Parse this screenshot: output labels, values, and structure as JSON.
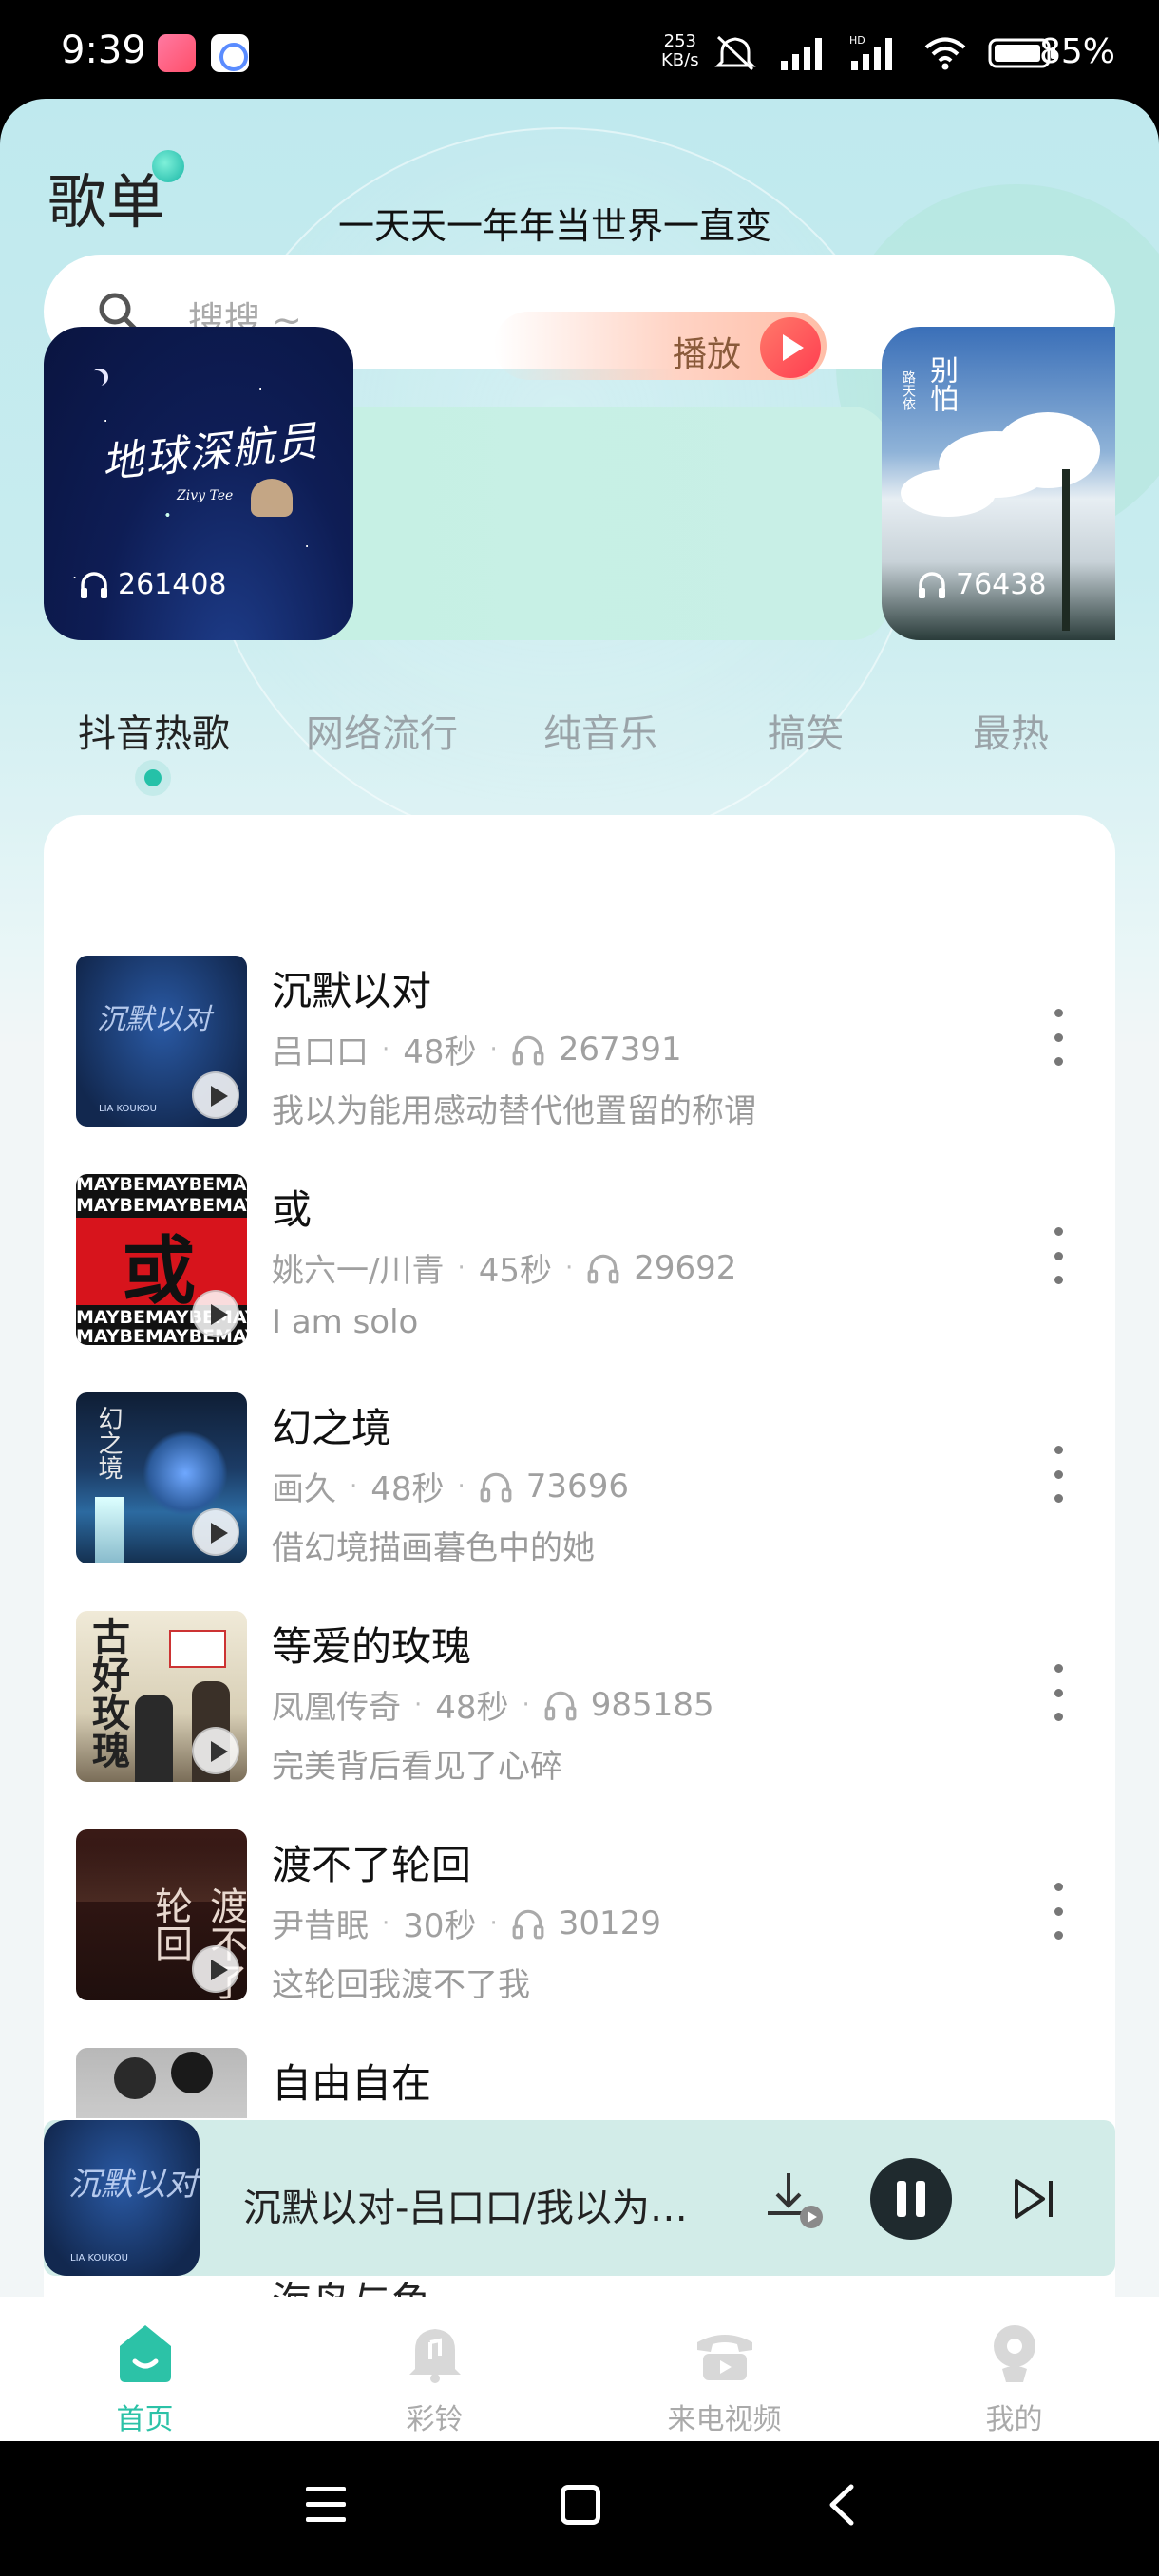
{
  "status_bar": {
    "time": "9:39",
    "net_speed_value": "253",
    "net_speed_unit": "KB/s",
    "battery": "85%",
    "icons": [
      "mute-icon",
      "signal-icon",
      "hd-signal-icon",
      "wifi-icon",
      "battery-icon"
    ]
  },
  "header": {
    "title": "歌单"
  },
  "search": {
    "placeholder": "搜搜 ~"
  },
  "banner": {
    "cover_title": "地球深航员",
    "cover_artist": "Zivy Tee",
    "play_count": "261408",
    "description": "一天天一年年当世界一直变",
    "play_label": "播放",
    "side_card": {
      "title": "别怕",
      "subtitle": "路天依",
      "play_count": "76438"
    }
  },
  "tabs": [
    {
      "label": "抖音热歌",
      "active": true
    },
    {
      "label": "网络流行",
      "active": false
    },
    {
      "label": "纯音乐",
      "active": false
    },
    {
      "label": "搞笑",
      "active": false
    },
    {
      "label": "最热",
      "active": false
    }
  ],
  "songs": [
    {
      "title": "沉默以对",
      "artist": "吕口口",
      "duration": "48秒",
      "plays": "267391",
      "lyric": "我以为能用感动替代他置留的称谓",
      "cover_text": "沉默以对"
    },
    {
      "title": "或",
      "artist": "姚六一/川青",
      "duration": "45秒",
      "plays": "29692",
      "lyric": "I am solo",
      "cover_text": "或"
    },
    {
      "title": "幻之境",
      "artist": "画久",
      "duration": "48秒",
      "plays": "73696",
      "lyric": "借幻境描画暮色中的她",
      "cover_text": "幻之境"
    },
    {
      "title": "等爱的玫瑰",
      "artist": "凤凰传奇",
      "duration": "48秒",
      "plays": "985185",
      "lyric": "完美背后看见了心碎",
      "cover_text": "古好玫瑰"
    },
    {
      "title": "渡不了轮回",
      "artist": "尹昔眠",
      "duration": "30秒",
      "plays": "30129",
      "lyric": "这轮回我渡不了我",
      "cover_text": "渡不了轮回"
    },
    {
      "title": "自由自在",
      "artist": "",
      "duration": "",
      "plays": "",
      "lyric": "",
      "cover_text": ""
    }
  ],
  "peek_song_title": "海鸟与鱼",
  "mini_player": {
    "title": "沉默以对-吕口口/我以为能用感动替代他置留的称谓",
    "cover_text": "沉默以对"
  },
  "bottom_nav": [
    {
      "label": "首页",
      "icon": "home-icon",
      "active": true
    },
    {
      "label": "彩铃",
      "icon": "bell-icon",
      "active": false
    },
    {
      "label": "来电视频",
      "icon": "phone-video-icon",
      "active": false
    },
    {
      "label": "我的",
      "icon": "profile-icon",
      "active": false
    }
  ],
  "colors": {
    "accent": "#2cc2a7",
    "play_red": "#ff3d50"
  }
}
